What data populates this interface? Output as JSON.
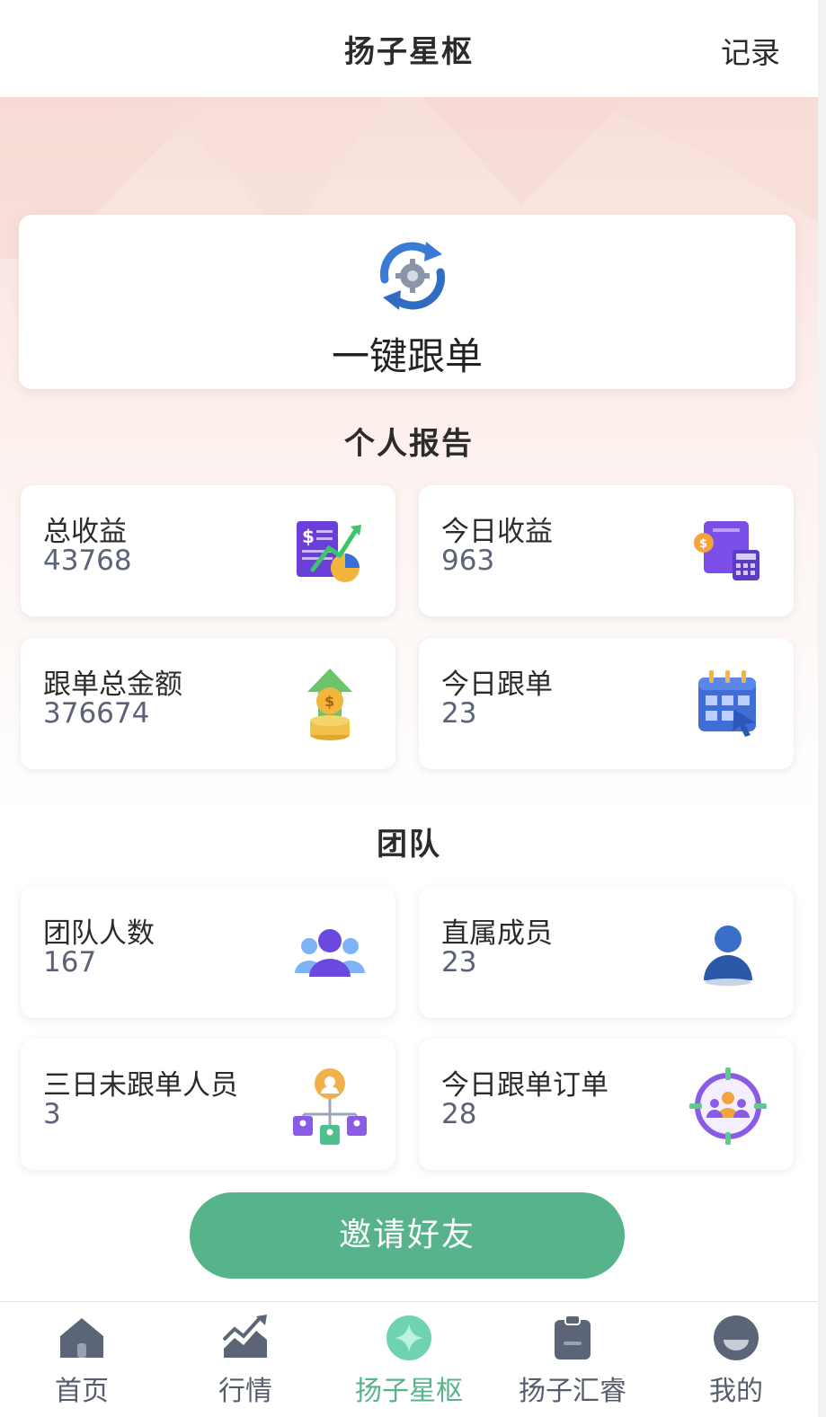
{
  "header": {
    "title": "扬子星枢",
    "record_label": "记录"
  },
  "follow_card": {
    "label": "一键跟单",
    "icon": "sync-gear-icon"
  },
  "personal_report": {
    "title": "个人报告",
    "cards": [
      {
        "label": "总收益",
        "value": "43768",
        "icon": "revenue-chart-icon"
      },
      {
        "label": "今日收益",
        "value": "963",
        "icon": "wallet-calculator-icon"
      },
      {
        "label": "跟单总金额",
        "value": "376674",
        "icon": "coins-up-icon"
      },
      {
        "label": "今日跟单",
        "value": "23",
        "icon": "calendar-icon"
      }
    ]
  },
  "team": {
    "title": "团队",
    "cards": [
      {
        "label": "团队人数",
        "value": "167",
        "icon": "group-users-icon"
      },
      {
        "label": "直属成员",
        "value": "23",
        "icon": "user-icon"
      },
      {
        "label": "三日未跟单人员",
        "value": "3",
        "icon": "org-chart-icon"
      },
      {
        "label": "今日跟单订单",
        "value": "28",
        "icon": "target-users-icon"
      }
    ]
  },
  "invite_button": "邀请好友",
  "tabbar": {
    "active_index": 2,
    "tabs": [
      {
        "label": "首页",
        "icon": "home-icon"
      },
      {
        "label": "行情",
        "icon": "market-trend-icon"
      },
      {
        "label": "扬子星枢",
        "icon": "star-icon"
      },
      {
        "label": "扬子汇睿",
        "icon": "clipboard-icon"
      },
      {
        "label": "我的",
        "icon": "profile-icon"
      }
    ]
  },
  "colors": {
    "accent": "#57b38a",
    "value_text": "#5c6378",
    "tab_inactive": "#555d6c",
    "background_top": "#f8dfda"
  }
}
